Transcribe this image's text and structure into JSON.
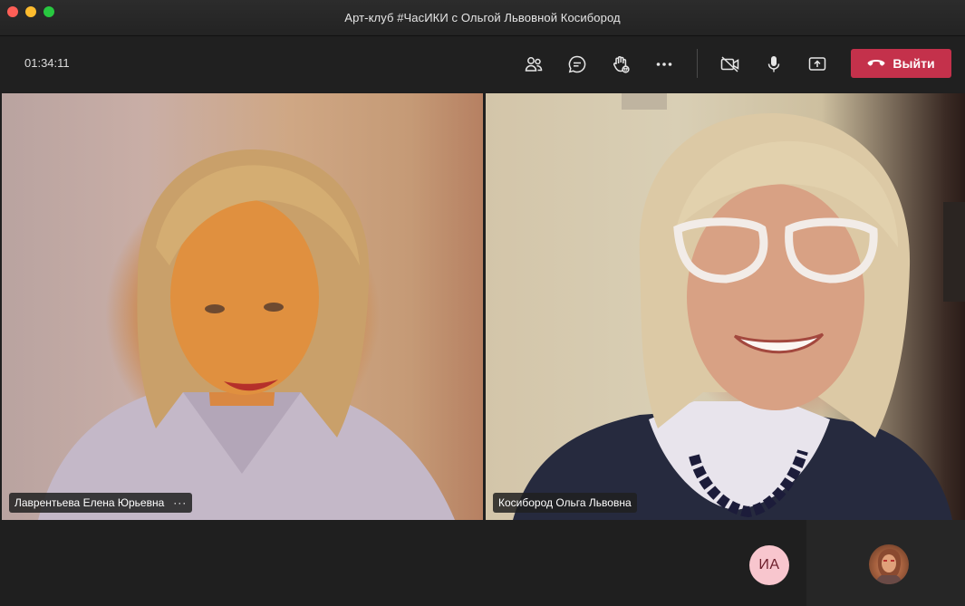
{
  "window": {
    "title": "Арт-клуб #ЧасИКИ с Ольгой Львовной Косибород"
  },
  "toolbar": {
    "timer": "01:34:11",
    "leave_label": "Выйти",
    "icons": [
      "people-icon",
      "chat-icon",
      "raise-hand-icon",
      "more-icon",
      "camera-off-icon",
      "mic-icon",
      "share-screen-icon",
      "hangup-icon"
    ]
  },
  "participants": [
    {
      "name": "Лаврентьева Елена Юрьевна",
      "more": "···"
    },
    {
      "name": "Косибород Ольга Львовна"
    }
  ],
  "bottom": {
    "initials": "ИА"
  },
  "colors": {
    "leave": "#c4314b",
    "initials_bg": "#f8c6ce"
  }
}
